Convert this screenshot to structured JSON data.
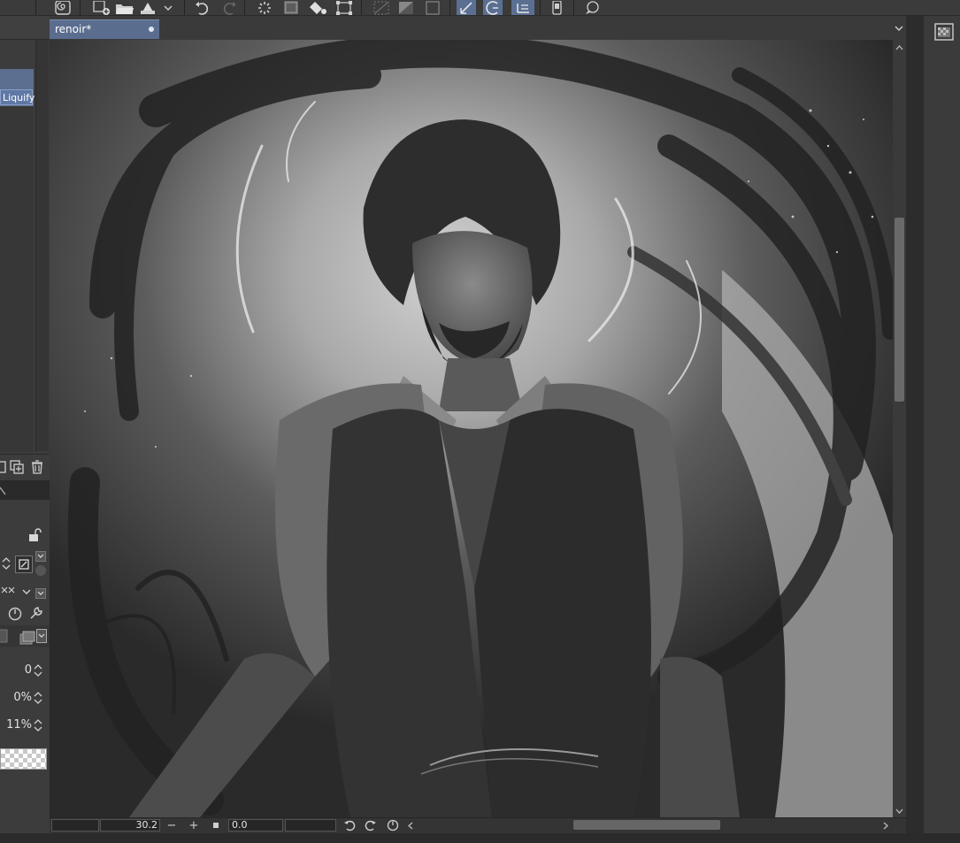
{
  "document": {
    "tab_title": "renoir*"
  },
  "layer_panel": {
    "selected_layer_label": "Liquify"
  },
  "properties": {
    "value_1": "0",
    "value_2": "0%",
    "value_3": "11%"
  },
  "statusbar": {
    "zoom_value": "30.2",
    "zoom_out_label": "−",
    "zoom_in_label": "+",
    "rotation_value": "0.0"
  },
  "icons": [
    "spiral-icon",
    "new-canvas-icon",
    "open-folder-icon",
    "save-icon",
    "undo-icon",
    "redo-icon",
    "loading-spinner-icon",
    "clear-icon",
    "fill-icon",
    "transform-icon",
    "hide-selection-icon",
    "invert-icon",
    "snap-to-ruler-icon",
    "snap-to-special-ruler-icon",
    "snap-to-grid-icon",
    "smartphone-icon",
    "chat-icon",
    "navigator-icon"
  ],
  "colors": {
    "accent": "#5b6d8f",
    "panel": "#3c3c3c",
    "toolbar": "#3b3b3b"
  }
}
